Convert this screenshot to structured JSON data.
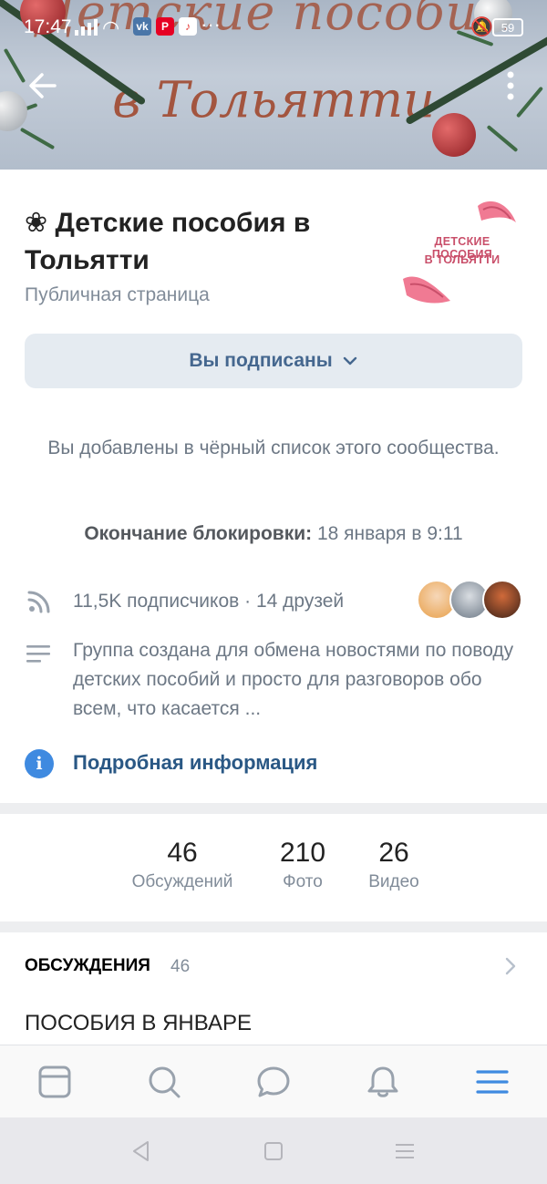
{
  "status_bar": {
    "time": "17:47",
    "battery": "59",
    "apps": [
      "vk",
      "pinterest",
      "music"
    ],
    "more": "···"
  },
  "cover": {
    "line1": "Детские пособия",
    "line2": "в Тольятти"
  },
  "group": {
    "flower_icon": "❀",
    "name": "Детские пособия в Тольятти",
    "type": "Публичная страница",
    "avatar_line1": "ДЕТСКИЕ ПОСОБИЯ",
    "avatar_line2": "В ТОЛЬЯТТИ"
  },
  "subscribe_button": "Вы подписаны",
  "blacklist_notice": "Вы добавлены в чёрный список этого сообщества.",
  "block_end": {
    "label": "Окончание блокировки:",
    "value": "18 января в 9:11"
  },
  "followers": "11,5K подписчиков · 14 друзей",
  "description": "Группа создана для обмена новостями по поводу детских пособий и просто для разговоров обо всем, что касается ...",
  "more_info": "Подробная информация",
  "counters": [
    {
      "num": "46",
      "label": "Обсуждений"
    },
    {
      "num": "210",
      "label": "Фото"
    },
    {
      "num": "26",
      "label": "Видео"
    }
  ],
  "discussions": {
    "header": "ОБСУЖДЕНИЯ",
    "count": "46",
    "first_topic": "ПОСОБИЯ В ЯНВАРЕ"
  },
  "tabs": [
    "news",
    "search",
    "messages",
    "notifications",
    "menu"
  ],
  "colors": {
    "accent": "#3f8ae0",
    "link": "#2a5885",
    "button_bg": "#e5ebf1",
    "button_text": "#45678f",
    "secondary_text": "#6d7885"
  }
}
